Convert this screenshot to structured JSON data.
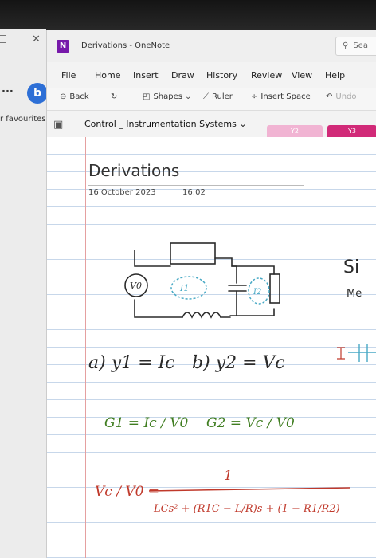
{
  "browser": {
    "favourites_label": "r favourites",
    "bing_letter": "b"
  },
  "window": {
    "app_icon": "N",
    "title": "Derivations - OneNote",
    "search_placeholder": "Sea"
  },
  "menu": [
    "File",
    "Home",
    "Insert",
    "Draw",
    "History",
    "Review",
    "View",
    "Help"
  ],
  "toolbar": {
    "back": "Back",
    "shapes": "Shapes",
    "ruler": "Ruler",
    "insert_space": "Insert Space",
    "undo": "Undo"
  },
  "notebook": {
    "section": "Control _ Instrumentation Systems",
    "tabs": [
      "Y2",
      "Y3"
    ]
  },
  "page": {
    "title": "Derivations",
    "date": "16 October 2023",
    "time": "16:02"
  },
  "handwriting": {
    "source_label": "V0",
    "loop1": "I1",
    "loop2": "I2",
    "part_a": "a) y1 = Ic",
    "part_b": "b) y2 = Vc",
    "g1": "G1 = Ic / V0",
    "g2": "G2 = Vc / V0",
    "tf_lhs": "Vc / V0 =",
    "tf_num": "1",
    "tf_den": "LCs² + (R1C − L/R)s + (1 − R1/R2)",
    "side_1": "Si",
    "side_2": "Me"
  },
  "colors": {
    "onenote_purple": "#7719aa",
    "tab_y2": "#f1b4d3",
    "tab_y3": "#d12a78",
    "ink_black": "#2a2a2a",
    "ink_green": "#3f7d20",
    "ink_blue": "#48a9c5",
    "ink_red": "#c0392b"
  }
}
